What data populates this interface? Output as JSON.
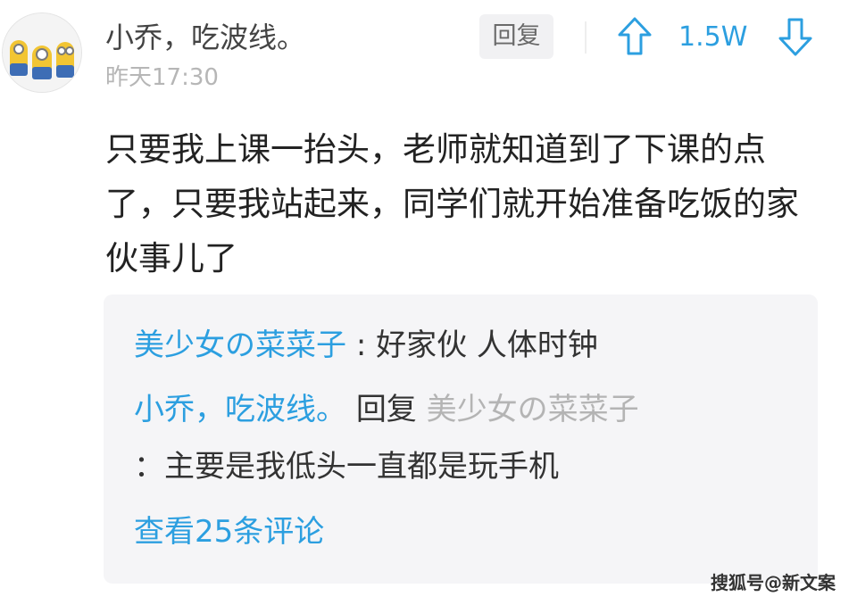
{
  "comment": {
    "username": "小乔，吃波线。",
    "timestamp": "昨天17:30",
    "reply_label": "回复",
    "vote_count": "1.5W",
    "text": "只要我上课一抬头，老师就知道到了下课的点了，只要我站起来，同学们就开始准备吃饭的家伙事儿了"
  },
  "replies": {
    "items": [
      {
        "author": "美少女の菜菜子",
        "separator": ":",
        "text": "好家伙 人体时钟"
      },
      {
        "author": "小乔，吃波线。",
        "reply_word": "回复",
        "reply_to": "美少女の菜菜子",
        "text": "：主要是我低头一直都是玩手机"
      }
    ],
    "view_more": "查看25条评论"
  },
  "watermark": "搜狐号@新文案",
  "colors": {
    "accent": "#2c9fe0",
    "panel_bg": "#f5f5f7",
    "muted": "#b6b6b6"
  },
  "icons": {
    "upvote": "arrow-up-icon",
    "downvote": "arrow-down-icon"
  }
}
